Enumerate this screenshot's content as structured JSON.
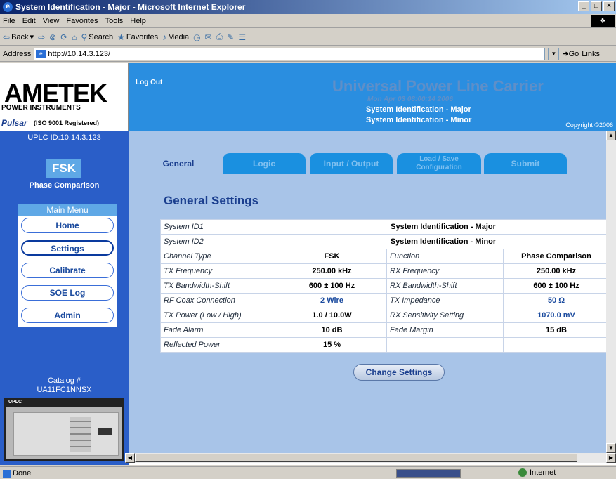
{
  "window": {
    "title": "System Identification - Major - Microsoft Internet Explorer",
    "buttons": [
      "_",
      "□",
      "×"
    ]
  },
  "menubar": {
    "items": [
      "File",
      "Edit",
      "View",
      "Favorites",
      "Tools",
      "Help"
    ]
  },
  "toolbar": {
    "back": "Back",
    "search": "Search",
    "favorites": "Favorites",
    "media": "Media"
  },
  "address": {
    "label": "Address",
    "url": "http://10.14.3.123/",
    "go": "Go",
    "links": "Links"
  },
  "header": {
    "brand": "AMETEK",
    "brand_sub": "POWER INSTRUMENTS",
    "pulsar": "Pulsar",
    "iso": "(ISO 9001 Registered)",
    "logout": "Log Out",
    "title": "Universal Power Line Carrier",
    "datetime": "Mon Apr 03 08:00:14 2006",
    "sys_major": "System Identification - Major",
    "sys_minor": "System Identification - Minor",
    "copyright": "Copyright ©2006"
  },
  "sidebar": {
    "uplc_id": "UPLC ID:10.14.3.123",
    "mode": "FSK",
    "mode_sub": "Phase Comparison",
    "menu_title": "Main Menu",
    "menu": [
      {
        "label": "Home"
      },
      {
        "label": "Settings"
      },
      {
        "label": "Calibrate"
      },
      {
        "label": "SOE Log"
      },
      {
        "label": "Admin"
      }
    ],
    "catalog_label": "Catalog #",
    "catalog_number": "UA11FC1NNSX",
    "device_label": "UPLC"
  },
  "tabs": [
    {
      "label": "General"
    },
    {
      "label": "Logic"
    },
    {
      "label": "Input / Output"
    },
    {
      "label_line1": "Load / Save",
      "label_line2": "Configuration"
    },
    {
      "label": "Submit"
    }
  ],
  "general": {
    "heading": "General Settings",
    "rows": {
      "sysid1": {
        "label": "System ID1",
        "value": "System Identification - Major"
      },
      "sysid2": {
        "label": "System ID2",
        "value": "System Identification - Minor"
      },
      "channel": {
        "label": "Channel Type",
        "value": "FSK",
        "label2": "Function",
        "value2": "Phase Comparison"
      },
      "txfreq": {
        "label": "TX Frequency",
        "value": "250.00 kHz",
        "label2": "RX Frequency",
        "value2": "250.00 kHz"
      },
      "txbw": {
        "label": "TX Bandwidth-Shift",
        "value": "600 ± 100 Hz",
        "label2": "RX Bandwidth-Shift",
        "value2": "600 ± 100 Hz"
      },
      "rfcoax": {
        "label": "RF Coax Connection",
        "value": "2 Wire",
        "label2": "TX Impedance",
        "value2": "50 Ω"
      },
      "txpower": {
        "label": "TX Power (Low / High)",
        "value": "1.0 / 10.0W",
        "label2": "RX Sensitivity Setting",
        "value2": "1070.0 mV"
      },
      "fade": {
        "label": "Fade Alarm",
        "value": "10 dB",
        "label2": "Fade Margin",
        "value2": "15 dB"
      },
      "reflected": {
        "label": "Reflected Power",
        "value": "15 %"
      }
    },
    "change_button": "Change Settings"
  },
  "status": {
    "text": "Done",
    "zone": "Internet"
  }
}
